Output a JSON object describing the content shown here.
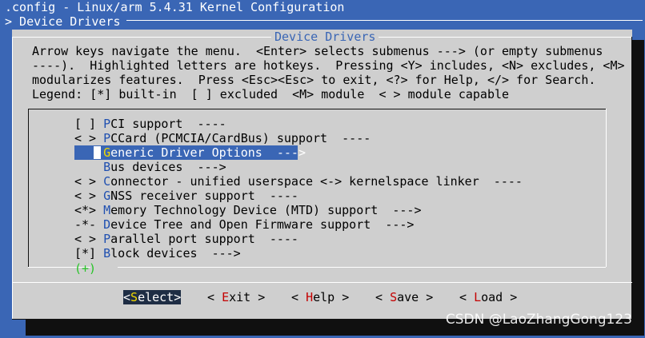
{
  "terminal": {
    "title_line": ".config - Linux/arm 5.4.31 Kernel Configuration",
    "breadcrumb": "> Device Drivers"
  },
  "dialog": {
    "title": "Device Drivers",
    "help_lines": [
      "Arrow keys navigate the menu.  <Enter> selects submenus ---> (or empty submenus",
      "----).  Highlighted letters are hotkeys.  Pressing <Y> includes, <N> excludes, <M>",
      "modularizes features.  Press <Esc><Esc> to exit, <?> for Help, </> for Search.",
      "Legend: [*] built-in  [ ] excluded  <M> module  < > module capable"
    ]
  },
  "menu": {
    "items": [
      {
        "prefix": "[ ] ",
        "hotkey": "P",
        "rest": "CI support  ----"
      },
      {
        "prefix": "< > ",
        "hotkey": "P",
        "rest": "CCard (PCMCIA/CardBus) support  ----"
      },
      {
        "prefix": "    ",
        "hotkey": "G",
        "rest": "eneric Driver Options  --->"
      },
      {
        "prefix": "    ",
        "hotkey": "B",
        "rest": "us devices  --->"
      },
      {
        "prefix": "< > ",
        "hotkey": "C",
        "rest": "onnector - unified userspace <-> kernelspace linker  ----"
      },
      {
        "prefix": "< > ",
        "hotkey": "G",
        "rest": "NSS receiver support  ----"
      },
      {
        "prefix": "<*> ",
        "hotkey": "M",
        "rest": "emory Technology Device (MTD) support  --->"
      },
      {
        "prefix": "-*- ",
        "hotkey": "D",
        "rest": "evice Tree and Open Firmware support  --->"
      },
      {
        "prefix": "< > ",
        "hotkey": "P",
        "rest": "arallel port support  ----"
      },
      {
        "prefix": "[*] ",
        "hotkey": "B",
        "rest": "lock devices  --->"
      }
    ],
    "selected_index": 2,
    "more_indicator": "(+)"
  },
  "buttons": [
    {
      "pre": "<",
      "hotkey": "S",
      "rest": "elect>"
    },
    {
      "pre": "< ",
      "hotkey": "E",
      "rest": "xit >"
    },
    {
      "pre": "< ",
      "hotkey": "H",
      "rest": "elp >"
    },
    {
      "pre": "< ",
      "hotkey": "S",
      "rest": "ave >"
    },
    {
      "pre": "< ",
      "hotkey": "L",
      "rest": "oad >"
    }
  ],
  "watermark": "CSDN @LaoZhangGong123",
  "colors": {
    "background": "#3a66b5",
    "dialog": "#cfcfcf",
    "hotkey": "#1f4fb0",
    "selected_hotkey": "#f2d900",
    "button_hotkey": "#c40000",
    "more_indicator": "#27c427"
  }
}
